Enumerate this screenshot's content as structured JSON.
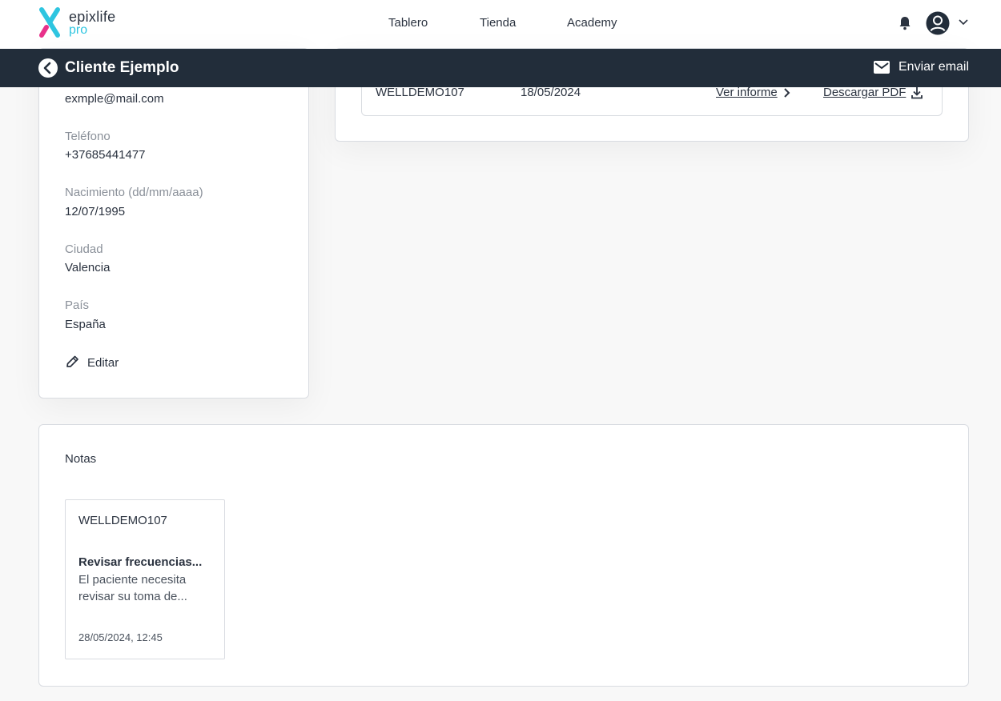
{
  "brand": {
    "name": "epixlife",
    "tagline": "pro"
  },
  "nav": {
    "items": [
      "Tablero",
      "Tienda",
      "Academy"
    ]
  },
  "subheader": {
    "title": "Cliente Ejemplo",
    "email_button": "Enviar email"
  },
  "client": {
    "email": "exmple@mail.com",
    "phone_label": "Teléfono",
    "phone": "+37685441477",
    "birth_label": "Nacimiento (dd/mm/aaaa)",
    "birth": "12/07/1995",
    "city_label": "Ciudad",
    "city": "Valencia",
    "country_label": "País",
    "country": "España",
    "edit_label": "Editar"
  },
  "reports": [
    {
      "code": "WELLDEMO107",
      "date": "18/05/2024",
      "view_label": "Ver informe",
      "download_label": "Descargar PDF"
    }
  ],
  "notes": {
    "title": "Notas",
    "items": [
      {
        "code": "WELLDEMO107",
        "title": "Revisar frecuencias...",
        "body": "El paciente necesita revisar su toma de...",
        "date": "28/05/2024, 12:45"
      }
    ]
  },
  "colors": {
    "header_dark": "#222d3a",
    "accent_cyan": "#2ec5e0",
    "accent_pink": "#e8318a"
  },
  "icons": [
    "bell-icon",
    "user-avatar-icon",
    "chevron-down-icon",
    "back-arrow-icon",
    "mail-icon",
    "pencil-icon",
    "chevron-right-icon",
    "download-icon"
  ]
}
